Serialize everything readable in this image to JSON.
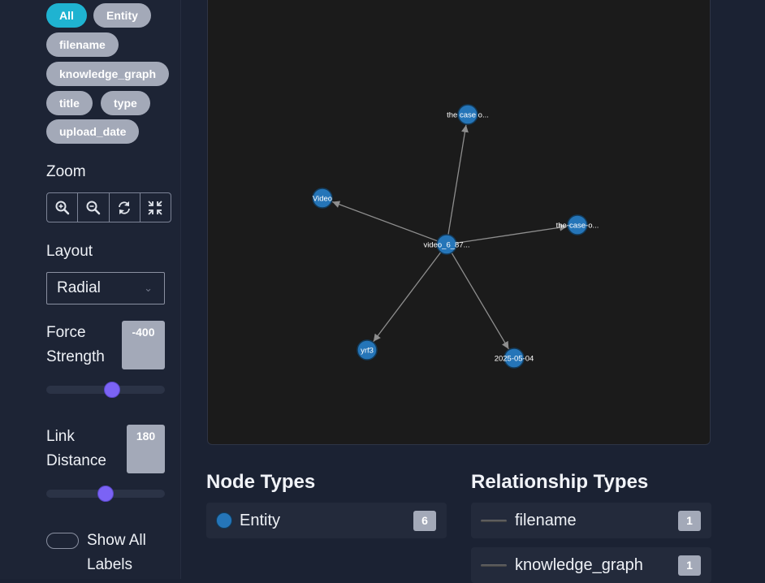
{
  "filters": {
    "chips": [
      {
        "label": "All",
        "active": true
      },
      {
        "label": "Entity",
        "active": false
      },
      {
        "label": "filename",
        "active": false
      },
      {
        "label": "knowledge_graph",
        "active": false
      },
      {
        "label": "title",
        "active": false
      },
      {
        "label": "type",
        "active": false
      },
      {
        "label": "upload_date",
        "active": false
      }
    ]
  },
  "zoom": {
    "label": "Zoom",
    "buttons": [
      "zoom-in-icon",
      "zoom-out-icon",
      "reset-icon",
      "fit-screen-icon"
    ]
  },
  "layout": {
    "label": "Layout",
    "selected": "Radial"
  },
  "force": {
    "label_line1": "Force",
    "label_line2": "Strength",
    "value": "-400",
    "slider_fraction": 0.56
  },
  "link": {
    "label_line1": "Link",
    "label_line2": "Distance",
    "value": "180",
    "slider_fraction": 0.5
  },
  "show_labels": {
    "label_line1": "Show All",
    "label_line2": "Labels",
    "enabled": false
  },
  "graph": {
    "center": {
      "id": "center",
      "label": "video_6_87..."
    },
    "nodes": [
      {
        "id": "title",
        "label": "the case o..."
      },
      {
        "id": "type",
        "label": "Video"
      },
      {
        "id": "filename",
        "label": "the-case-o..."
      },
      {
        "id": "kg",
        "label": "yrf3"
      },
      {
        "id": "date",
        "label": "2025-05-04"
      }
    ],
    "node_color": "#2575b8",
    "edge_color": "#8e8e8e"
  },
  "node_types": {
    "title": "Node Types",
    "items": [
      {
        "label": "Entity",
        "count": "6",
        "color": "#2575b8"
      }
    ]
  },
  "relationship_types": {
    "title": "Relationship Types",
    "items": [
      {
        "label": "filename",
        "count": "1"
      },
      {
        "label": "knowledge_graph",
        "count": "1"
      }
    ]
  }
}
